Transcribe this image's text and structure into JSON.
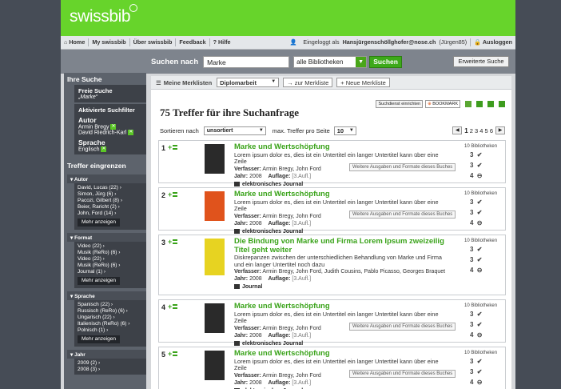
{
  "brand": "swissbib",
  "topnav": {
    "home": "Home",
    "my": "My swissbib",
    "about": "Über swissbib",
    "feedback": "Feedback",
    "help": "? Hilfe",
    "logged_prefix": "Eingeloggt als",
    "user": "Hansjürgenschöllghofer@nose.ch",
    "alias": "(Jürgen85)",
    "logout": "Ausloggen"
  },
  "search": {
    "label": "Suchen nach",
    "value": "Marke",
    "scope": "alle Bibliotheken",
    "button": "Suchen",
    "advanced": "Erweiterte Suche"
  },
  "sidebar": {
    "your_search": "Ihre Suche",
    "free_search_label": "Freie Suche",
    "free_search_value": "„Marke“",
    "active_filters": "Aktivierte Suchfilter",
    "author_label": "Autor",
    "authors": [
      "Armin Bregy",
      "David Riedrich-Karl"
    ],
    "language_label": "Sprache",
    "language": "Englisch",
    "narrow": "Treffer eingrenzen",
    "more": "Mehr anzeigen",
    "facets": [
      {
        "title": "Autor",
        "items": [
          "David, Lucas (22)",
          "Simon, Jürg (6)",
          "Pacozi, Gilbert (8)",
          "Beier, Raricht (2)",
          "John, Ford (14)"
        ]
      },
      {
        "title": "Format",
        "items": [
          "Video (22)",
          "Musik (ReRo) (6)",
          "Video (22)",
          "Musik (ReRo) (6)",
          "Journal (1)"
        ]
      },
      {
        "title": "Sprache",
        "items": [
          "Spanisch (22)",
          "Russisch (ReRo) (6)",
          "Ungarisch (22)",
          "Italienisch (ReRo) (6)",
          "Polnisch (1)"
        ]
      },
      {
        "title": "Jahr",
        "items": [
          "2009 (2)",
          "2008 (3)"
        ]
      }
    ]
  },
  "mylists": {
    "label": "Meine Merklisten",
    "current": "Diplomarbeit",
    "to_list": "zur Merkliste",
    "new_list": "Neue Merkliste"
  },
  "results_title": "75 Treffer für ihre Suchanfrage",
  "tools": {
    "service": "Suchdienst einrichten",
    "bookmark": "BOOKMARK"
  },
  "sort": {
    "label": "Sortieren nach",
    "value": "unsortiert",
    "max_label": "max. Treffer pro Seite",
    "max_value": "10"
  },
  "pager": {
    "current": "1",
    "others": "2 3 4 5 6"
  },
  "labels": {
    "author": "Verfasser:",
    "year": "Jahr:",
    "edition": "Auflage:",
    "more_editions": "Weitere Ausgaben und Formate dieses Buches",
    "libraries": "10 Bibliotheken"
  },
  "results": [
    {
      "no": "1",
      "title": "Marke und Wertschöpfung",
      "desc": "Lorem ipsum dolor es, dies ist ein Untertitel ein langer Untertitel kann über eine Zeile",
      "authors": "Armin Bregy, John Ford",
      "year": "2008",
      "edition": "[3.Aufl.]",
      "type": "elektronisches Journal",
      "cover": "#2a2a2a",
      "lib": [
        "3",
        "3",
        "4"
      ]
    },
    {
      "no": "2",
      "title": "Marke und Wertschöpfung",
      "desc": "Lorem ipsum dolor es, dies ist ein Untertitel ein langer Untertitel kann über eine Zeile",
      "authors": "Armin Bregy, John Ford",
      "year": "2008",
      "edition": "[3.Aufl.]",
      "type": "elektronisches Journal",
      "cover": "#e0531c",
      "lib": [
        "3",
        "3",
        "4"
      ]
    },
    {
      "no": "3",
      "title": "Die Bindung von Marke und Firma Lorem Ipsum zweizeilig Titel geht weiter",
      "desc": "Diskrepanzen zwischen der unterschiedlichen Behandlung von Marke und Firma und ein langer Untertitel noch dazu",
      "authors": "Armin Bregy, John Ford, Judith Cousins, Pablo Picasso, Georges Braquet",
      "year": "2008",
      "edition": "[3.Aufl.]",
      "type": "Journal",
      "cover": "#e7d321",
      "lib": [
        "3",
        "3",
        "4"
      ]
    },
    {
      "no": "4",
      "title": "Marke und Wertschöpfung",
      "desc": "Lorem ipsum dolor es, dies ist ein Untertitel ein langer Untertitel kann über eine Zeile",
      "authors": "Armin Bregy, John Ford",
      "year": "2008",
      "edition": "[3.Aufl.]",
      "type": "elektronisches Journal",
      "cover": "#2a2a2a",
      "lib": [
        "3",
        "3",
        "4"
      ]
    },
    {
      "no": "5",
      "title": "Marke und Wertschöpfung",
      "desc": "Lorem ipsum dolor es, dies ist ein Untertitel ein langer Untertitel kann über eine Zeile",
      "authors": "Armin Bregy, John Ford",
      "year": "2008",
      "edition": "[3.Aufl.]",
      "type": "elektronisches Journal",
      "cover": "#2a2a2a",
      "lib": [
        "3",
        "3",
        "4"
      ]
    }
  ]
}
